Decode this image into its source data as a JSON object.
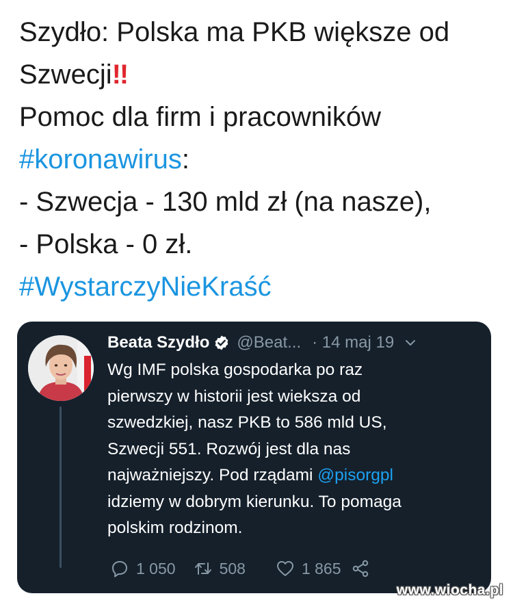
{
  "post": {
    "line1": "Szydło: Polska ma PKB większe od",
    "line2_text": "Szwecji",
    "line2_emoji": "!!",
    "line3": "Pomoc dla firm i pracowników",
    "hashtag1": "#koronawirus",
    "hashtag1_suffix": ":",
    "line5": "- Szwecja - 130 mld zł (na nasze),",
    "line6": "- Polska - 0 zł.",
    "hashtag2": "#WystarczyNieKraść"
  },
  "quoted_tweet": {
    "author_name": "Beata Szydło",
    "handle": "@Beat...",
    "date": "· 14 maj 19",
    "lines": [
      "Wg IMF polska gospodarka po raz",
      "pierwszy w historii jest wieksza od",
      "szwedzkiej, nasz PKB to 586 mld US,",
      "Szwecji 551. Rozwój jest dla nas"
    ],
    "line5_text": "najważniejszy. Pod rządami ",
    "mention": "@pisorgpl",
    "lines_after": [
      "idziemy w dobrym kierunku. To pomaga",
      "polskim rodzinom."
    ],
    "reply_count": "1 050",
    "retweet_count": "508",
    "like_count": "1 865"
  },
  "watermark": "www.wiocha.pl",
  "icons": {
    "verified": "verified-badge-icon",
    "caret": "chevron-down-icon",
    "reply": "reply-icon",
    "retweet": "retweet-icon",
    "like": "heart-icon",
    "share": "share-icon"
  },
  "colors": {
    "hashtag": "#1b95e0",
    "card_bg": "#15202b",
    "muted": "#8899a6",
    "mention": "#1da1f2",
    "emoji_red": "#e0262e"
  }
}
